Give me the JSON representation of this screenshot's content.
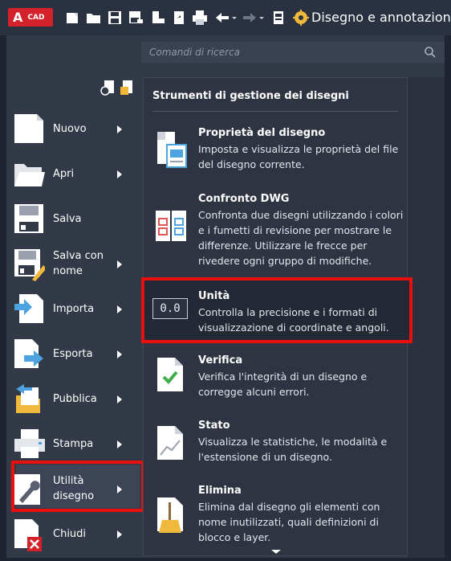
{
  "titlebar": {
    "logo_letter": "A",
    "logo_text": "CAD",
    "workspace": "Disegno e annotazione",
    "brand_color": "#d3222a"
  },
  "search": {
    "placeholder": "Comandi di ricerca"
  },
  "left_menu": {
    "items": [
      {
        "label": "Nuovo",
        "icon": "new-file-icon"
      },
      {
        "label": "Apri",
        "icon": "open-folder-icon"
      },
      {
        "label": "Salva",
        "icon": "save-icon"
      },
      {
        "label": "Salva con nome",
        "icon": "save-as-icon"
      },
      {
        "label": "Importa",
        "icon": "import-icon"
      },
      {
        "label": "Esporta",
        "icon": "export-icon"
      },
      {
        "label": "Pubblica",
        "icon": "publish-icon"
      },
      {
        "label": "Stampa",
        "icon": "print-icon"
      },
      {
        "label": "Utilità disegno",
        "icon": "wrench-icon",
        "selected": true
      },
      {
        "label": "Chiudi",
        "icon": "close-file-icon"
      }
    ]
  },
  "submenu": {
    "heading": "Strumenti di gestione dei disegni",
    "items": [
      {
        "title": "Proprietà del disegno",
        "desc": "Imposta e visualizza le proprietà del file del disegno corrente.",
        "icon": "drawing-properties-icon"
      },
      {
        "title": "Confronto DWG",
        "desc": "Confronta due disegni utilizzando i colori e i fumetti di revisione per mostrare le differenze. Utilizzare le frecce per rivedere ogni gruppo di modifiche.",
        "icon": "dwg-compare-icon"
      },
      {
        "title": "Unità",
        "desc": "Controlla la precisione e i formati di visualizzazione di coordinate e angoli.",
        "icon": "units-icon",
        "icon_text": "0.0",
        "highlighted": true
      },
      {
        "title": "Verifica",
        "desc": "Verifica l'integrità di un disegno e corregge alcuni errori.",
        "icon": "audit-icon"
      },
      {
        "title": "Stato",
        "desc": "Visualizza le statistiche, le modalità e l'estensione di un disegno.",
        "icon": "status-icon"
      },
      {
        "title": "Elimina",
        "desc": "Elimina dal disegno gli elementi con nome inutilizzati, quali definizioni di blocco e layer.",
        "icon": "purge-icon"
      }
    ]
  },
  "highlight_color": "#ea0e0e"
}
